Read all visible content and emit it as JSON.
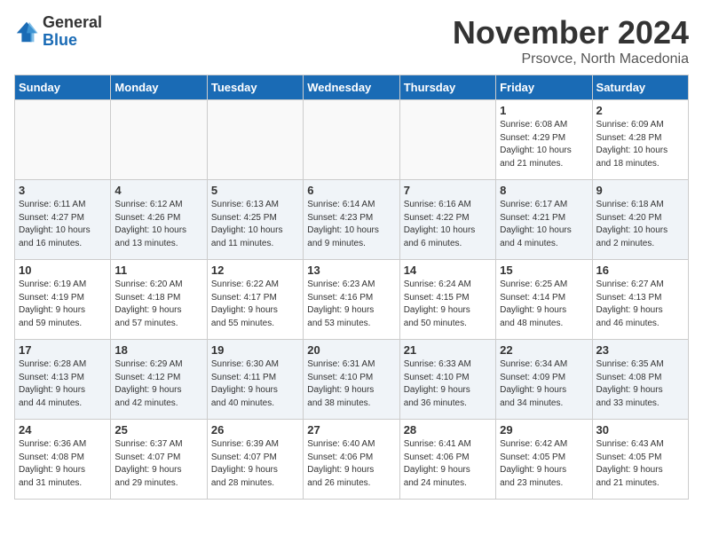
{
  "logo": {
    "general": "General",
    "blue": "Blue"
  },
  "title": "November 2024",
  "location": "Prsovce, North Macedonia",
  "days_of_week": [
    "Sunday",
    "Monday",
    "Tuesday",
    "Wednesday",
    "Thursday",
    "Friday",
    "Saturday"
  ],
  "weeks": [
    [
      {
        "day": "",
        "info": ""
      },
      {
        "day": "",
        "info": ""
      },
      {
        "day": "",
        "info": ""
      },
      {
        "day": "",
        "info": ""
      },
      {
        "day": "",
        "info": ""
      },
      {
        "day": "1",
        "info": "Sunrise: 6:08 AM\nSunset: 4:29 PM\nDaylight: 10 hours\nand 21 minutes."
      },
      {
        "day": "2",
        "info": "Sunrise: 6:09 AM\nSunset: 4:28 PM\nDaylight: 10 hours\nand 18 minutes."
      }
    ],
    [
      {
        "day": "3",
        "info": "Sunrise: 6:11 AM\nSunset: 4:27 PM\nDaylight: 10 hours\nand 16 minutes."
      },
      {
        "day": "4",
        "info": "Sunrise: 6:12 AM\nSunset: 4:26 PM\nDaylight: 10 hours\nand 13 minutes."
      },
      {
        "day": "5",
        "info": "Sunrise: 6:13 AM\nSunset: 4:25 PM\nDaylight: 10 hours\nand 11 minutes."
      },
      {
        "day": "6",
        "info": "Sunrise: 6:14 AM\nSunset: 4:23 PM\nDaylight: 10 hours\nand 9 minutes."
      },
      {
        "day": "7",
        "info": "Sunrise: 6:16 AM\nSunset: 4:22 PM\nDaylight: 10 hours\nand 6 minutes."
      },
      {
        "day": "8",
        "info": "Sunrise: 6:17 AM\nSunset: 4:21 PM\nDaylight: 10 hours\nand 4 minutes."
      },
      {
        "day": "9",
        "info": "Sunrise: 6:18 AM\nSunset: 4:20 PM\nDaylight: 10 hours\nand 2 minutes."
      }
    ],
    [
      {
        "day": "10",
        "info": "Sunrise: 6:19 AM\nSunset: 4:19 PM\nDaylight: 9 hours\nand 59 minutes."
      },
      {
        "day": "11",
        "info": "Sunrise: 6:20 AM\nSunset: 4:18 PM\nDaylight: 9 hours\nand 57 minutes."
      },
      {
        "day": "12",
        "info": "Sunrise: 6:22 AM\nSunset: 4:17 PM\nDaylight: 9 hours\nand 55 minutes."
      },
      {
        "day": "13",
        "info": "Sunrise: 6:23 AM\nSunset: 4:16 PM\nDaylight: 9 hours\nand 53 minutes."
      },
      {
        "day": "14",
        "info": "Sunrise: 6:24 AM\nSunset: 4:15 PM\nDaylight: 9 hours\nand 50 minutes."
      },
      {
        "day": "15",
        "info": "Sunrise: 6:25 AM\nSunset: 4:14 PM\nDaylight: 9 hours\nand 48 minutes."
      },
      {
        "day": "16",
        "info": "Sunrise: 6:27 AM\nSunset: 4:13 PM\nDaylight: 9 hours\nand 46 minutes."
      }
    ],
    [
      {
        "day": "17",
        "info": "Sunrise: 6:28 AM\nSunset: 4:13 PM\nDaylight: 9 hours\nand 44 minutes."
      },
      {
        "day": "18",
        "info": "Sunrise: 6:29 AM\nSunset: 4:12 PM\nDaylight: 9 hours\nand 42 minutes."
      },
      {
        "day": "19",
        "info": "Sunrise: 6:30 AM\nSunset: 4:11 PM\nDaylight: 9 hours\nand 40 minutes."
      },
      {
        "day": "20",
        "info": "Sunrise: 6:31 AM\nSunset: 4:10 PM\nDaylight: 9 hours\nand 38 minutes."
      },
      {
        "day": "21",
        "info": "Sunrise: 6:33 AM\nSunset: 4:10 PM\nDaylight: 9 hours\nand 36 minutes."
      },
      {
        "day": "22",
        "info": "Sunrise: 6:34 AM\nSunset: 4:09 PM\nDaylight: 9 hours\nand 34 minutes."
      },
      {
        "day": "23",
        "info": "Sunrise: 6:35 AM\nSunset: 4:08 PM\nDaylight: 9 hours\nand 33 minutes."
      }
    ],
    [
      {
        "day": "24",
        "info": "Sunrise: 6:36 AM\nSunset: 4:08 PM\nDaylight: 9 hours\nand 31 minutes."
      },
      {
        "day": "25",
        "info": "Sunrise: 6:37 AM\nSunset: 4:07 PM\nDaylight: 9 hours\nand 29 minutes."
      },
      {
        "day": "26",
        "info": "Sunrise: 6:39 AM\nSunset: 4:07 PM\nDaylight: 9 hours\nand 28 minutes."
      },
      {
        "day": "27",
        "info": "Sunrise: 6:40 AM\nSunset: 4:06 PM\nDaylight: 9 hours\nand 26 minutes."
      },
      {
        "day": "28",
        "info": "Sunrise: 6:41 AM\nSunset: 4:06 PM\nDaylight: 9 hours\nand 24 minutes."
      },
      {
        "day": "29",
        "info": "Sunrise: 6:42 AM\nSunset: 4:05 PM\nDaylight: 9 hours\nand 23 minutes."
      },
      {
        "day": "30",
        "info": "Sunrise: 6:43 AM\nSunset: 4:05 PM\nDaylight: 9 hours\nand 21 minutes."
      }
    ]
  ]
}
